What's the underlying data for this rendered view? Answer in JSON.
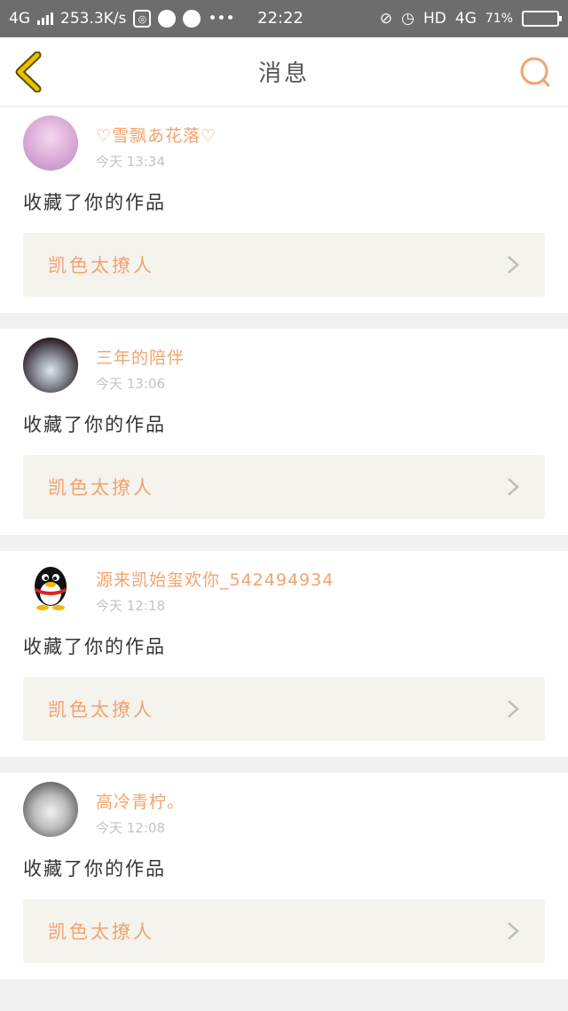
{
  "status": {
    "network": "4G",
    "speed": "253.3K/s",
    "time": "22:22",
    "hd": "HD",
    "network2": "4G",
    "battery": "71%",
    "battery_level": 0.71
  },
  "nav": {
    "title": "消息"
  },
  "messages": [
    {
      "name": "♡雪飘あ花落♡",
      "time": "今天 13:34",
      "action": "收藏了你的作品",
      "work": "凯色太撩人",
      "avatar": "photo-pink"
    },
    {
      "name": "三年的陪伴",
      "time": "今天 13:06",
      "action": "收藏了你的作品",
      "work": "凯色太撩人",
      "avatar": "photo-dark"
    },
    {
      "name": "源来凯始玺欢你_542494934",
      "time": "今天 12:18",
      "action": "收藏了你的作品",
      "work": "凯色太撩人",
      "avatar": "qq-penguin"
    },
    {
      "name": "高冷青柠。",
      "time": "今天 12:08",
      "action": "收藏了你的作品",
      "work": "凯色太撩人",
      "avatar": "photo-girl"
    }
  ],
  "colors": {
    "accent": "#f2a36e",
    "back": "#e8c200",
    "search": "#f2a36e"
  }
}
